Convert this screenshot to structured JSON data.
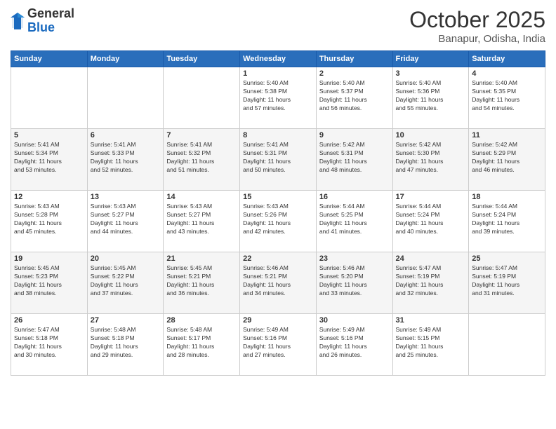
{
  "logo": {
    "general": "General",
    "blue": "Blue"
  },
  "title": "October 2025",
  "subtitle": "Banapur, Odisha, India",
  "days_header": [
    "Sunday",
    "Monday",
    "Tuesday",
    "Wednesday",
    "Thursday",
    "Friday",
    "Saturday"
  ],
  "weeks": [
    [
      {
        "day": "",
        "content": ""
      },
      {
        "day": "",
        "content": ""
      },
      {
        "day": "",
        "content": ""
      },
      {
        "day": "1",
        "content": "Sunrise: 5:40 AM\nSunset: 5:38 PM\nDaylight: 11 hours\nand 57 minutes."
      },
      {
        "day": "2",
        "content": "Sunrise: 5:40 AM\nSunset: 5:37 PM\nDaylight: 11 hours\nand 56 minutes."
      },
      {
        "day": "3",
        "content": "Sunrise: 5:40 AM\nSunset: 5:36 PM\nDaylight: 11 hours\nand 55 minutes."
      },
      {
        "day": "4",
        "content": "Sunrise: 5:40 AM\nSunset: 5:35 PM\nDaylight: 11 hours\nand 54 minutes."
      }
    ],
    [
      {
        "day": "5",
        "content": "Sunrise: 5:41 AM\nSunset: 5:34 PM\nDaylight: 11 hours\nand 53 minutes."
      },
      {
        "day": "6",
        "content": "Sunrise: 5:41 AM\nSunset: 5:33 PM\nDaylight: 11 hours\nand 52 minutes."
      },
      {
        "day": "7",
        "content": "Sunrise: 5:41 AM\nSunset: 5:32 PM\nDaylight: 11 hours\nand 51 minutes."
      },
      {
        "day": "8",
        "content": "Sunrise: 5:41 AM\nSunset: 5:31 PM\nDaylight: 11 hours\nand 50 minutes."
      },
      {
        "day": "9",
        "content": "Sunrise: 5:42 AM\nSunset: 5:31 PM\nDaylight: 11 hours\nand 48 minutes."
      },
      {
        "day": "10",
        "content": "Sunrise: 5:42 AM\nSunset: 5:30 PM\nDaylight: 11 hours\nand 47 minutes."
      },
      {
        "day": "11",
        "content": "Sunrise: 5:42 AM\nSunset: 5:29 PM\nDaylight: 11 hours\nand 46 minutes."
      }
    ],
    [
      {
        "day": "12",
        "content": "Sunrise: 5:43 AM\nSunset: 5:28 PM\nDaylight: 11 hours\nand 45 minutes."
      },
      {
        "day": "13",
        "content": "Sunrise: 5:43 AM\nSunset: 5:27 PM\nDaylight: 11 hours\nand 44 minutes."
      },
      {
        "day": "14",
        "content": "Sunrise: 5:43 AM\nSunset: 5:27 PM\nDaylight: 11 hours\nand 43 minutes."
      },
      {
        "day": "15",
        "content": "Sunrise: 5:43 AM\nSunset: 5:26 PM\nDaylight: 11 hours\nand 42 minutes."
      },
      {
        "day": "16",
        "content": "Sunrise: 5:44 AM\nSunset: 5:25 PM\nDaylight: 11 hours\nand 41 minutes."
      },
      {
        "day": "17",
        "content": "Sunrise: 5:44 AM\nSunset: 5:24 PM\nDaylight: 11 hours\nand 40 minutes."
      },
      {
        "day": "18",
        "content": "Sunrise: 5:44 AM\nSunset: 5:24 PM\nDaylight: 11 hours\nand 39 minutes."
      }
    ],
    [
      {
        "day": "19",
        "content": "Sunrise: 5:45 AM\nSunset: 5:23 PM\nDaylight: 11 hours\nand 38 minutes."
      },
      {
        "day": "20",
        "content": "Sunrise: 5:45 AM\nSunset: 5:22 PM\nDaylight: 11 hours\nand 37 minutes."
      },
      {
        "day": "21",
        "content": "Sunrise: 5:45 AM\nSunset: 5:21 PM\nDaylight: 11 hours\nand 36 minutes."
      },
      {
        "day": "22",
        "content": "Sunrise: 5:46 AM\nSunset: 5:21 PM\nDaylight: 11 hours\nand 34 minutes."
      },
      {
        "day": "23",
        "content": "Sunrise: 5:46 AM\nSunset: 5:20 PM\nDaylight: 11 hours\nand 33 minutes."
      },
      {
        "day": "24",
        "content": "Sunrise: 5:47 AM\nSunset: 5:19 PM\nDaylight: 11 hours\nand 32 minutes."
      },
      {
        "day": "25",
        "content": "Sunrise: 5:47 AM\nSunset: 5:19 PM\nDaylight: 11 hours\nand 31 minutes."
      }
    ],
    [
      {
        "day": "26",
        "content": "Sunrise: 5:47 AM\nSunset: 5:18 PM\nDaylight: 11 hours\nand 30 minutes."
      },
      {
        "day": "27",
        "content": "Sunrise: 5:48 AM\nSunset: 5:18 PM\nDaylight: 11 hours\nand 29 minutes."
      },
      {
        "day": "28",
        "content": "Sunrise: 5:48 AM\nSunset: 5:17 PM\nDaylight: 11 hours\nand 28 minutes."
      },
      {
        "day": "29",
        "content": "Sunrise: 5:49 AM\nSunset: 5:16 PM\nDaylight: 11 hours\nand 27 minutes."
      },
      {
        "day": "30",
        "content": "Sunrise: 5:49 AM\nSunset: 5:16 PM\nDaylight: 11 hours\nand 26 minutes."
      },
      {
        "day": "31",
        "content": "Sunrise: 5:49 AM\nSunset: 5:15 PM\nDaylight: 11 hours\nand 25 minutes."
      },
      {
        "day": "",
        "content": ""
      }
    ]
  ]
}
